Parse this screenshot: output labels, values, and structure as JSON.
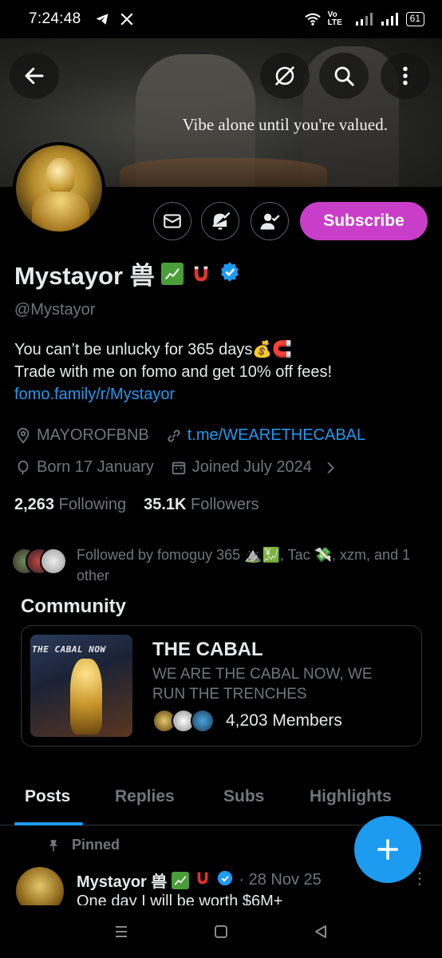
{
  "status_bar": {
    "time": "7:24:48",
    "battery": "61",
    "network_label": "Vo LTE"
  },
  "banner": {
    "caption": "Vibe alone until you're valued."
  },
  "profile": {
    "name": "Mystayor 兽",
    "handle": "@Mystayor",
    "bio_line1": "You can’t be unlucky for 365 days💰🧲",
    "bio_line2": "Trade with me on fomo and get 10% off fees!",
    "bio_link": "fomo.family/r/Mystayor",
    "location": "MAYOROFBNB",
    "website": "t.me/WEARETHECABAL",
    "born": "Born 17 January",
    "joined": "Joined July 2024",
    "following_count": "2,263",
    "following_label": "Following",
    "followers_count": "35.1K",
    "followers_label": "Followers",
    "followed_by": "Followed by fomoguy 365 ⛰️💹, Tac 💸, xzm, and 1 other",
    "subscribe_label": "Subscribe"
  },
  "community": {
    "section_title": "Community",
    "image_text": "THE CABAL NOW",
    "name": "THE CABAL",
    "description": "WE ARE THE CABAL NOW, WE RUN THE TRENCHES",
    "members": "4,203 Members"
  },
  "tabs": [
    {
      "label": "Posts"
    },
    {
      "label": "Replies"
    },
    {
      "label": "Subs"
    },
    {
      "label": "Highlights"
    }
  ],
  "post": {
    "pinned_label": "Pinned",
    "author": "Mystayor 兽",
    "date": "· 28 Nov 25",
    "text": "One day I will be worth $6M+"
  },
  "colors": {
    "accent": "#1d9bf0",
    "subscribe": "#c93ec8",
    "muted": "#71767b",
    "background": "#000000"
  }
}
